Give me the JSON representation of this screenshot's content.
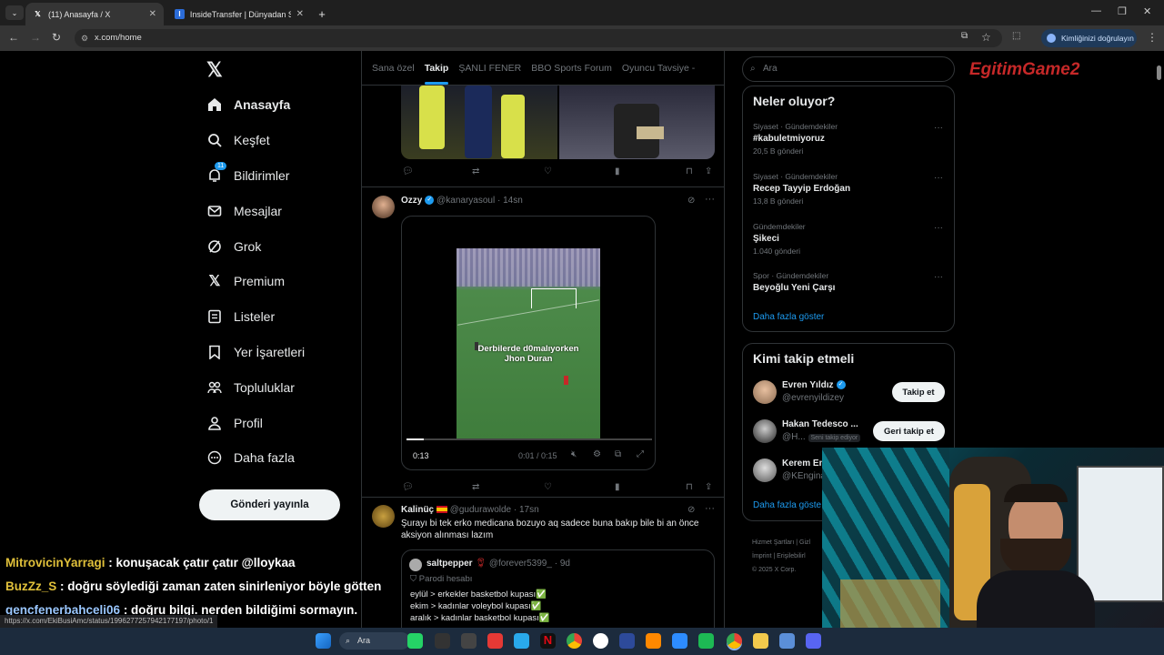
{
  "browser": {
    "tabs": [
      {
        "title": "(11) Anasayfa / X",
        "active": true
      },
      {
        "title": "InsideTransfer | Dünyadan Son",
        "active": false
      }
    ],
    "url": "x.com/home",
    "verify_label": "Kimliğinizi doğrulayın",
    "status_url": "https://x.com/EkiBusiAmc/status/1996277257942177197/photo/1"
  },
  "nav": {
    "items": [
      {
        "label": "Anasayfa",
        "icon": "home-icon"
      },
      {
        "label": "Keşfet",
        "icon": "search-icon"
      },
      {
        "label": "Bildirimler",
        "icon": "bell-icon",
        "badge": "11"
      },
      {
        "label": "Mesajlar",
        "icon": "mail-icon"
      },
      {
        "label": "Grok",
        "icon": "grok-icon"
      },
      {
        "label": "Premium",
        "icon": "x-icon"
      },
      {
        "label": "Listeler",
        "icon": "list-icon"
      },
      {
        "label": "Yer İşaretleri",
        "icon": "bookmark-icon"
      },
      {
        "label": "Topluluklar",
        "icon": "communities-icon"
      },
      {
        "label": "Profil",
        "icon": "profile-icon"
      },
      {
        "label": "Daha fazla",
        "icon": "more-icon"
      }
    ],
    "post_button": "Gönderi yayınla"
  },
  "feed": {
    "tabs": [
      "Sana özel",
      "Takip",
      "ŞANLI FENER",
      "BBO Sports Forum",
      "Oyuncu Tavsiye -"
    ],
    "active_tab": "Takip",
    "post1": {
      "name": "Ozzy",
      "handle": "@kanaryasoul · 14sn",
      "video_caption": "Derbilerde d0malıyorken Jhon Duran",
      "duration": "0:13",
      "time": "0:01 / 0:15"
    },
    "post2": {
      "name": "Kalinüç",
      "handle": "@gudurawolde · 17sn",
      "text": "Şurayı bi tek erko medicana bozuyo aq sadece buna bakıp bile bi an önce aksiyon alınması lazım",
      "quote": {
        "name": "saltpepper",
        "handle": "@forever5399_ · 9d",
        "parody": "Parodi hesabı",
        "lines": [
          "eylül > erkekler basketbol kupası✅",
          "ekim > kadınlar voleybol kupası✅",
          "aralık > kadınlar basketbol kupası✅"
        ]
      }
    }
  },
  "search": {
    "placeholder": "Ara"
  },
  "trends": {
    "title": "Neler oluyor?",
    "items": [
      {
        "category": "Siyaset · Gündemdekiler",
        "name": "#kabuletmiyoruz",
        "count": "20,5 B gönderi"
      },
      {
        "category": "Siyaset · Gündemdekiler",
        "name": "Recep Tayyip Erdoğan",
        "count": "13,8 B gönderi"
      },
      {
        "category": "Gündemdekiler",
        "name": "Şikeci",
        "count": "1.040 gönderi"
      },
      {
        "category": "Spor · Gündemdekiler",
        "name": "Beyoğlu Yeni Çarşı",
        "count": ""
      }
    ],
    "show_more": "Daha fazla göster"
  },
  "who_to_follow": {
    "title": "Kimi takip etmeli",
    "users": [
      {
        "name": "Evren Yıldız",
        "handle": "@evrenyildizey",
        "button": "Takip et"
      },
      {
        "name": "Hakan Tedesco ...",
        "handle": "@H...",
        "tag": "Seni takip ediyor",
        "button": "Geri takip et"
      },
      {
        "name": "Kerem En",
        "handle": "@KEngina"
      }
    ],
    "show_more": "Daha fazla göste"
  },
  "footer": {
    "links": [
      "Hizmet Şartları",
      "Gizl",
      "İmprint",
      "Erişilebilirl"
    ],
    "copyright": "© 2025 X Corp."
  },
  "chat": [
    {
      "user": "MitrovicinYarragi",
      "msg": " : konuşacak çatır çatır @lloykaa",
      "color": "#e0c03a"
    },
    {
      "user": "BuzZz_S",
      "msg": " : doğru söylediği zaman zaten sinirleniyor böyle götten",
      "color": "#e0c03a"
    },
    {
      "user": "gencfenerbahceli06",
      "msg": " : doğru bilgi. nerden bildiğimi sormayın.",
      "color": "#9ac7ff"
    }
  ],
  "overlay_logo": "EgitimGame2",
  "taskbar": {
    "search": "Ara"
  }
}
